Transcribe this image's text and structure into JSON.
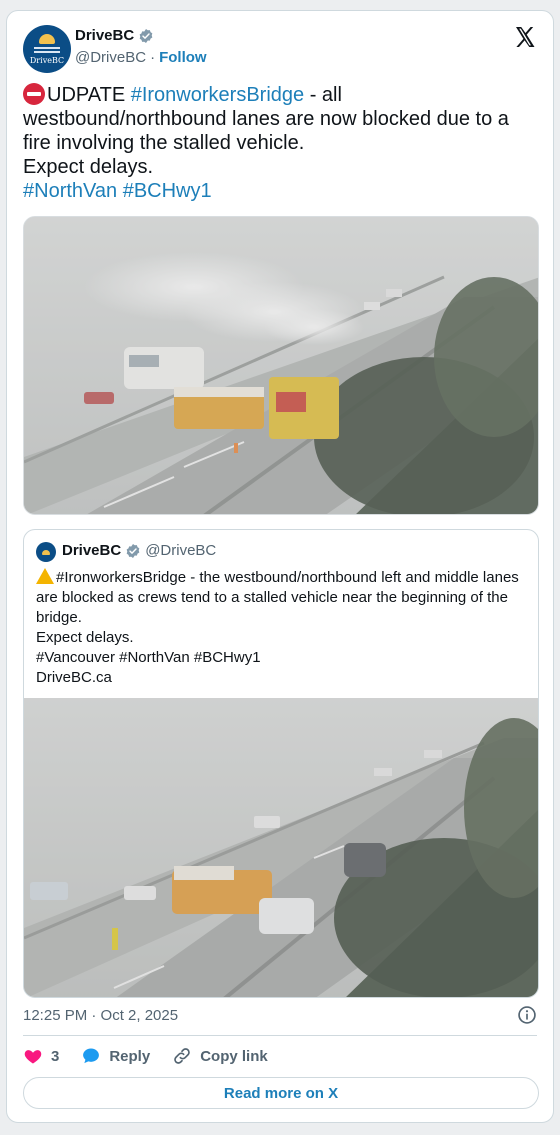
{
  "author": {
    "display_name": "DriveBC",
    "handle": "@DriveBC",
    "separator": "·",
    "follow_label": "Follow",
    "avatar_wordmark": "DriveBC"
  },
  "tweet": {
    "line1_prefix": "UDPATE ",
    "line1_hashtag": "#IronworkersBridge",
    "line1_suffix": " - all westbound/northbound lanes are now blocked due to a fire involving the stalled vehicle.",
    "line2": "Expect delays.",
    "hashtags": [
      "#NorthVan",
      "#BCHwy1"
    ]
  },
  "quoted_tweet": {
    "display_name": "DriveBC",
    "handle": "@DriveBC",
    "line1": "#IronworkersBridge - the westbound/northbound left and middle lanes are blocked as crews tend to a stalled vehicle near the beginning of the bridge.",
    "line2": "Expect delays.",
    "line3": "#Vancouver #NorthVan #BCHwy1",
    "line4": "DriveBC.ca"
  },
  "meta": {
    "timestamp": "12:25 PM · Oct 2, 2025"
  },
  "actions": {
    "like_count": "3",
    "reply_label": "Reply",
    "copy_label": "Copy link"
  },
  "footer": {
    "read_more_label": "Read more on X"
  },
  "colors": {
    "link": "#1d7fb9",
    "muted": "#536471",
    "heart": "#f91880",
    "reply_bubble": "#1d9bf0",
    "brand": "#0b4d86"
  },
  "icons": {
    "verified": "verified-badge-icon",
    "x_logo": "x-logo-icon",
    "info": "info-icon",
    "like": "heart-icon",
    "reply": "reply-bubble-icon",
    "copy": "link-icon"
  }
}
